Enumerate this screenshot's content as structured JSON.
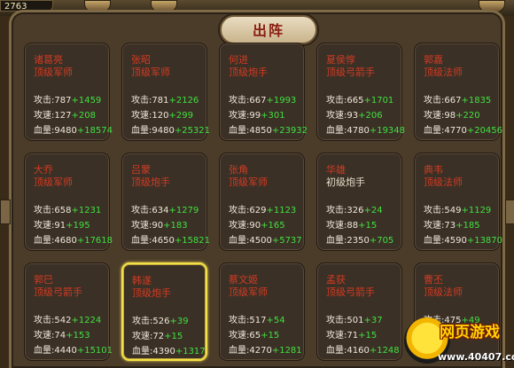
{
  "header": {
    "coins": "2763",
    "title": "出阵"
  },
  "stat_labels": {
    "attack": "攻击:",
    "speed": "攻速:",
    "hp": "血量:"
  },
  "generals": [
    {
      "name": "诸葛亮",
      "role": "顶级军师",
      "attack": "787",
      "attack_bonus": "+1459",
      "speed": "127",
      "speed_bonus": "+208",
      "hp": "9480",
      "hp_bonus": "+18574"
    },
    {
      "name": "张昭",
      "role": "顶级军师",
      "attack": "781",
      "attack_bonus": "+2126",
      "speed": "120",
      "speed_bonus": "+299",
      "hp": "9480",
      "hp_bonus": "+25321"
    },
    {
      "name": "何进",
      "role": "顶级炮手",
      "attack": "667",
      "attack_bonus": "+1993",
      "speed": "99",
      "speed_bonus": "+301",
      "hp": "4850",
      "hp_bonus": "+23932"
    },
    {
      "name": "夏侯惇",
      "role": "顶级弓箭手",
      "attack": "665",
      "attack_bonus": "+1701",
      "speed": "93",
      "speed_bonus": "+206",
      "hp": "4780",
      "hp_bonus": "+19348"
    },
    {
      "name": "郭嘉",
      "role": "顶级法师",
      "attack": "667",
      "attack_bonus": "+1835",
      "speed": "98",
      "speed_bonus": "+220",
      "hp": "4770",
      "hp_bonus": "+20456"
    },
    {
      "name": "大乔",
      "role": "顶级军师",
      "attack": "658",
      "attack_bonus": "+1231",
      "speed": "91",
      "speed_bonus": "+195",
      "hp": "4680",
      "hp_bonus": "+17618"
    },
    {
      "name": "吕蒙",
      "role": "顶级炮手",
      "attack": "634",
      "attack_bonus": "+1279",
      "speed": "90",
      "speed_bonus": "+183",
      "hp": "4650",
      "hp_bonus": "+15821"
    },
    {
      "name": "张角",
      "role": "顶级军师",
      "attack": "629",
      "attack_bonus": "+1123",
      "speed": "90",
      "speed_bonus": "+165",
      "hp": "4500",
      "hp_bonus": "+5737"
    },
    {
      "name": "华雄",
      "role": "初级炮手",
      "attack": "326",
      "attack_bonus": "+24",
      "speed": "88",
      "speed_bonus": "+15",
      "hp": "2350",
      "hp_bonus": "+705"
    },
    {
      "name": "典韦",
      "role": "顶级法师",
      "attack": "549",
      "attack_bonus": "+1129",
      "speed": "73",
      "speed_bonus": "+185",
      "hp": "4590",
      "hp_bonus": "+13870"
    },
    {
      "name": "郭巳",
      "role": "顶级弓箭手",
      "attack": "542",
      "attack_bonus": "+1224",
      "speed": "74",
      "speed_bonus": "+153",
      "hp": "4440",
      "hp_bonus": "+15101"
    },
    {
      "name": "韩遂",
      "role": "顶级炮手",
      "attack": "526",
      "attack_bonus": "+39",
      "speed": "72",
      "speed_bonus": "+15",
      "hp": "4390",
      "hp_bonus": "+1317"
    },
    {
      "name": "蔡文姬",
      "role": "顶级军师",
      "attack": "517",
      "attack_bonus": "+54",
      "speed": "65",
      "speed_bonus": "+15",
      "hp": "4270",
      "hp_bonus": "+1281"
    },
    {
      "name": "孟获",
      "role": "顶级弓箭手",
      "attack": "501",
      "attack_bonus": "+37",
      "speed": "71",
      "speed_bonus": "+15",
      "hp": "4160",
      "hp_bonus": "+1248"
    },
    {
      "name": "曹丕",
      "role": "顶级法师",
      "attack": "475",
      "attack_bonus": "+49",
      "speed": "",
      "speed_bonus": "",
      "hp": "",
      "hp_bonus": ""
    }
  ],
  "watermark": {
    "title": "网页游戏",
    "url": "www.40407.com"
  },
  "colors": {
    "name_red": "#d23b22",
    "bonus_green": "#40e040",
    "selected_border": "#f5e04a"
  }
}
